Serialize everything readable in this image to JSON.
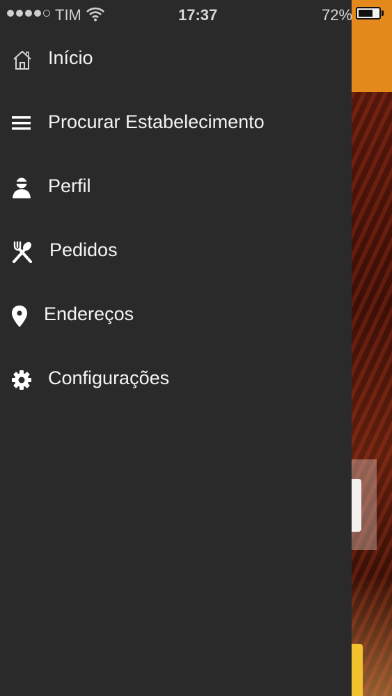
{
  "status_bar": {
    "carrier": "TIM",
    "time": "17:37",
    "battery_percent": "72%",
    "battery_level": 0.72,
    "signal_bars_filled": 4,
    "signal_bars_total": 5
  },
  "menu": {
    "items": [
      {
        "label": "Início",
        "icon": "home-icon"
      },
      {
        "label": "Procurar Estabelecimento",
        "icon": "menu-lines-icon"
      },
      {
        "label": "Perfil",
        "icon": "user-icon"
      },
      {
        "label": "Pedidos",
        "icon": "fork-spoon-icon"
      },
      {
        "label": "Endereços",
        "icon": "map-pin-icon"
      },
      {
        "label": "Configurações",
        "icon": "gear-icon"
      }
    ]
  },
  "colors": {
    "drawer_background": "#2b2a2b",
    "menu_text": "#f4f4f4",
    "app_header_accent": "#e48a1c"
  }
}
